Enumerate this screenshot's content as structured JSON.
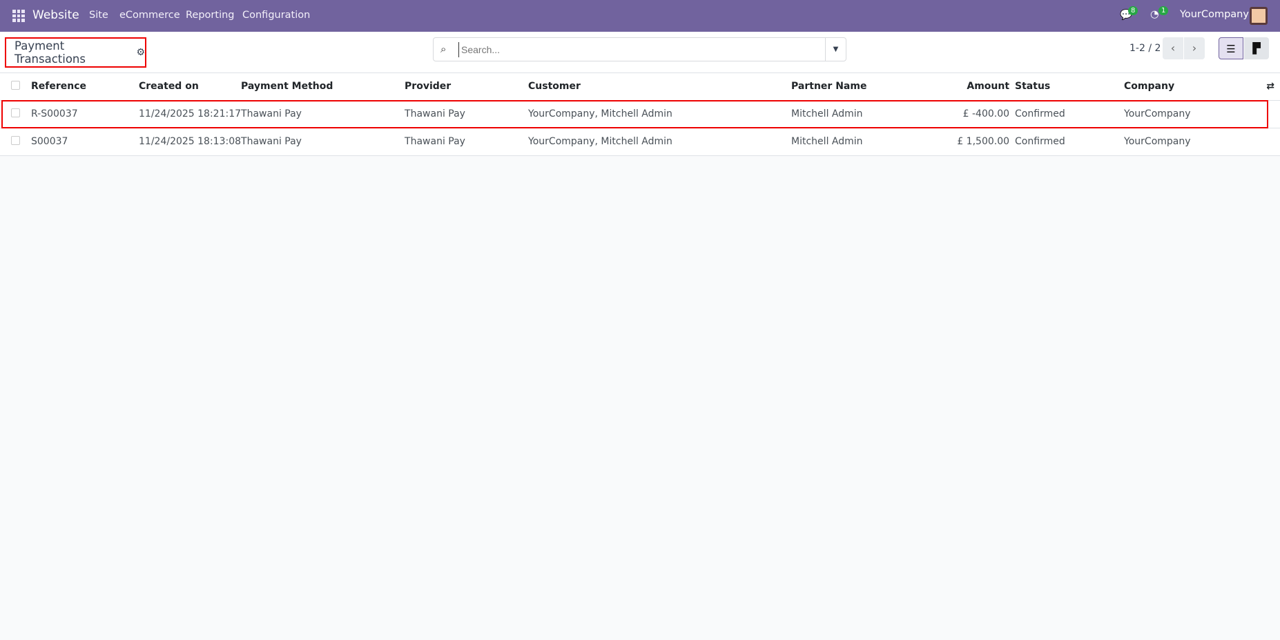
{
  "nav": {
    "app": "Website",
    "menus": [
      "Site",
      "eCommerce",
      "Reporting",
      "Configuration"
    ],
    "messages_count": "8",
    "activities_count": "1",
    "company": "YourCompany"
  },
  "control": {
    "title": "Payment Transactions",
    "search_placeholder": "Search...",
    "pager": "1-2 / 2"
  },
  "table": {
    "headers": [
      "Reference",
      "Created on",
      "Payment Method",
      "Provider",
      "Customer",
      "Partner Name",
      "Amount",
      "Status",
      "Company"
    ],
    "rows": [
      [
        "R-S00037",
        "11/24/2025 18:21:17",
        "Thawani Pay",
        "Thawani Pay",
        "YourCompany, Mitchell Admin",
        "Mitchell Admin",
        "£ -400.00",
        "Confirmed",
        "YourCompany"
      ],
      [
        "S00037",
        "11/24/2025 18:13:08",
        "Thawani Pay",
        "Thawani Pay",
        "YourCompany, Mitchell Admin",
        "Mitchell Admin",
        "£ 1,500.00",
        "Confirmed",
        "YourCompany"
      ]
    ]
  }
}
